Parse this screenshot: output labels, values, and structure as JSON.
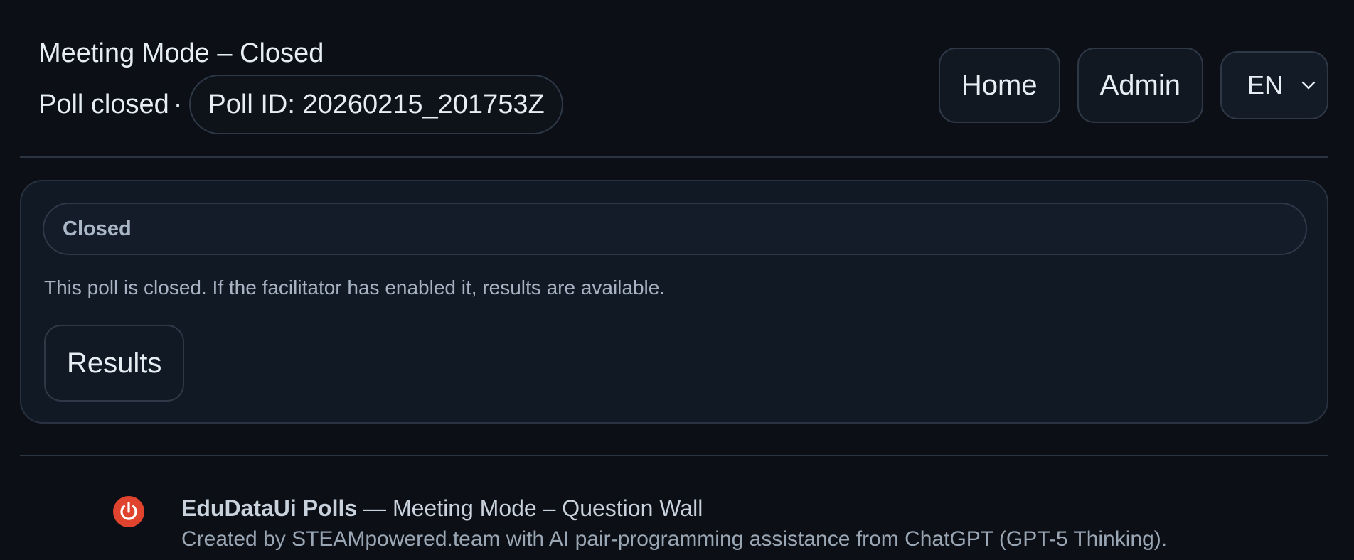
{
  "header": {
    "title": "Meeting Mode – Closed",
    "status": "Poll closed",
    "separator": "·",
    "poll_id": "Poll ID: 20260215_201753Z"
  },
  "nav": {
    "home_label": "Home",
    "admin_label": "Admin",
    "language": {
      "selected": "EN",
      "icon": "chevron-down-icon"
    }
  },
  "card": {
    "badge": "Closed",
    "message": "This poll is closed. If the facilitator has enabled it, results are available.",
    "results_label": "Results"
  },
  "footer": {
    "icon": "power-icon",
    "icon_color": "#e0442e",
    "brand": "EduDataUi Polls",
    "subtitle": " — Meeting Mode – Question Wall",
    "credits": "Created by STEAMpowered.team with AI pair-programming assistance from ChatGPT (GPT-5 Thinking)."
  },
  "colors": {
    "background": "#0c1016",
    "card": "#111924",
    "border": "#2e3846",
    "text": "#e6edf3",
    "muted_text": "#a7b3c2"
  }
}
